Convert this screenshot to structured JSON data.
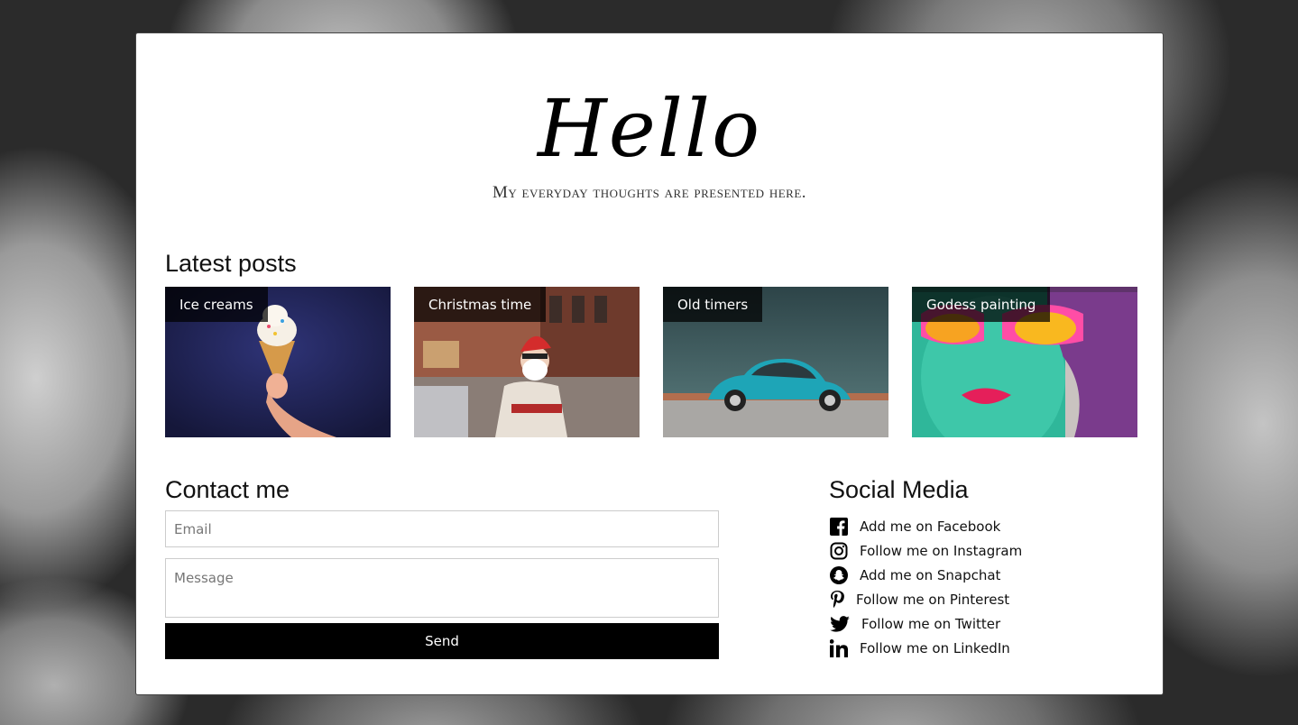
{
  "hero": {
    "title": "Hello",
    "subtitle": "My everyday thoughts are presented here."
  },
  "posts": {
    "heading": "Latest posts",
    "items": [
      {
        "label": "Ice creams"
      },
      {
        "label": "Christmas time"
      },
      {
        "label": "Old timers"
      },
      {
        "label": "Godess painting"
      }
    ]
  },
  "contact": {
    "heading": "Contact me",
    "email_placeholder": "Email",
    "message_placeholder": "Message",
    "send_label": "Send"
  },
  "social": {
    "heading": "Social Media",
    "items": [
      {
        "icon": "facebook-icon",
        "label": "Add me on Facebook"
      },
      {
        "icon": "instagram-icon",
        "label": "Follow me on Instagram"
      },
      {
        "icon": "snapchat-icon",
        "label": "Add me on Snapchat"
      },
      {
        "icon": "pinterest-icon",
        "label": "Follow me on Pinterest"
      },
      {
        "icon": "twitter-icon",
        "label": "Follow me on Twitter"
      },
      {
        "icon": "linkedin-icon",
        "label": "Follow me on LinkedIn"
      }
    ]
  },
  "colors": {
    "card_bg": "#ffffff",
    "button_bg": "#000000",
    "label_overlay": "#000000",
    "page_bg": "#2b2b2b"
  }
}
